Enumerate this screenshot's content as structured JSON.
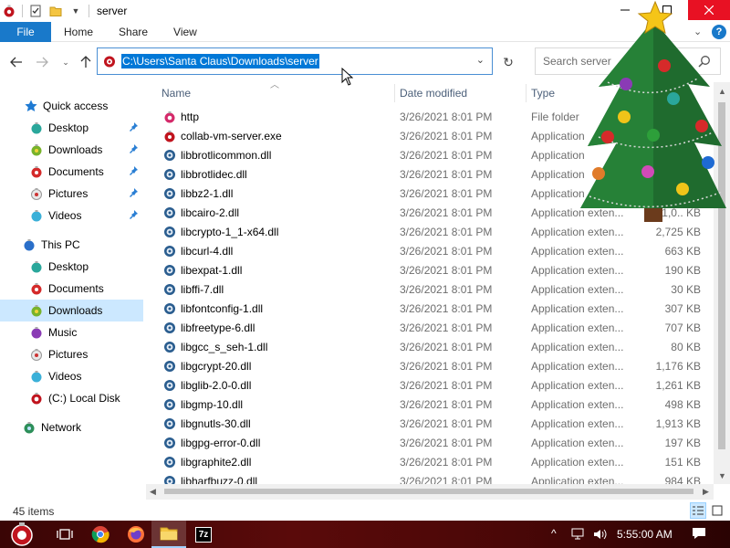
{
  "window": {
    "title": "server",
    "help_label": "?"
  },
  "ribbon": {
    "tabs": [
      "File",
      "Home",
      "Share",
      "View"
    ]
  },
  "address": {
    "path": "C:\\Users\\Santa Claus\\Downloads\\server",
    "search_placeholder": "Search server"
  },
  "nav": {
    "quick_access_label": "Quick access",
    "quick_access": [
      "Desktop",
      "Downloads",
      "Documents",
      "Pictures",
      "Videos"
    ],
    "this_pc_label": "This PC",
    "this_pc": [
      "Desktop",
      "Documents",
      "Downloads",
      "Music",
      "Pictures",
      "Videos",
      "(C:) Local Disk"
    ],
    "network_label": "Network"
  },
  "columns": {
    "name": "Name",
    "date": "Date modified",
    "type": "Type"
  },
  "files": [
    {
      "name": "http",
      "date": "3/26/2021 8:01 PM",
      "type": "File folder",
      "size": ""
    },
    {
      "name": "collab-vm-server.exe",
      "date": "3/26/2021 8:01 PM",
      "type": "Application",
      "size": ""
    },
    {
      "name": "libbrotlicommon.dll",
      "date": "3/26/2021 8:01 PM",
      "type": "Application",
      "size": ""
    },
    {
      "name": "libbrotlidec.dll",
      "date": "3/26/2021 8:01 PM",
      "type": "Application",
      "size": ""
    },
    {
      "name": "libbz2-1.dll",
      "date": "3/26/2021 8:01 PM",
      "type": "Application",
      "size": ""
    },
    {
      "name": "libcairo-2.dll",
      "date": "3/26/2021 8:01 PM",
      "type": "Application exten...",
      "size": "1,0.. KB"
    },
    {
      "name": "libcrypto-1_1-x64.dll",
      "date": "3/26/2021 8:01 PM",
      "type": "Application exten...",
      "size": "2,725 KB"
    },
    {
      "name": "libcurl-4.dll",
      "date": "3/26/2021 8:01 PM",
      "type": "Application exten...",
      "size": "663 KB"
    },
    {
      "name": "libexpat-1.dll",
      "date": "3/26/2021 8:01 PM",
      "type": "Application exten...",
      "size": "190 KB"
    },
    {
      "name": "libffi-7.dll",
      "date": "3/26/2021 8:01 PM",
      "type": "Application exten...",
      "size": "30 KB"
    },
    {
      "name": "libfontconfig-1.dll",
      "date": "3/26/2021 8:01 PM",
      "type": "Application exten...",
      "size": "307 KB"
    },
    {
      "name": "libfreetype-6.dll",
      "date": "3/26/2021 8:01 PM",
      "type": "Application exten...",
      "size": "707 KB"
    },
    {
      "name": "libgcc_s_seh-1.dll",
      "date": "3/26/2021 8:01 PM",
      "type": "Application exten...",
      "size": "80 KB"
    },
    {
      "name": "libgcrypt-20.dll",
      "date": "3/26/2021 8:01 PM",
      "type": "Application exten...",
      "size": "1,176 KB"
    },
    {
      "name": "libglib-2.0-0.dll",
      "date": "3/26/2021 8:01 PM",
      "type": "Application exten...",
      "size": "1,261 KB"
    },
    {
      "name": "libgmp-10.dll",
      "date": "3/26/2021 8:01 PM",
      "type": "Application exten...",
      "size": "498 KB"
    },
    {
      "name": "libgnutls-30.dll",
      "date": "3/26/2021 8:01 PM",
      "type": "Application exten...",
      "size": "1,913 KB"
    },
    {
      "name": "libgpg-error-0.dll",
      "date": "3/26/2021 8:01 PM",
      "type": "Application exten...",
      "size": "197 KB"
    },
    {
      "name": "libgraphite2.dll",
      "date": "3/26/2021 8:01 PM",
      "type": "Application exten...",
      "size": "151 KB"
    },
    {
      "name": "libharfbuzz-0.dll",
      "date": "3/26/2021 8:01 PM",
      "type": "Application exten...",
      "size": "984 KB"
    }
  ],
  "status": {
    "item_count": "45 items"
  },
  "taskbar": {
    "icons": [
      "start-orb-icon",
      "task-view-icon",
      "chrome-icon",
      "firefox-icon",
      "file-explorer-icon",
      "7zip-icon"
    ],
    "zip_label": "7z",
    "time": "5:55:00 AM"
  },
  "colors": {
    "accent": "#1979ca",
    "selection": "#cce8ff",
    "highlight": "#0078d7",
    "close": "#e81123"
  }
}
